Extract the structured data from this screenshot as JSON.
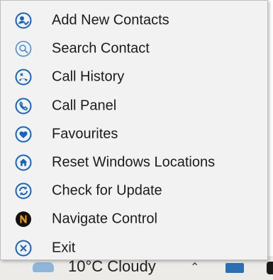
{
  "menu": {
    "items": [
      {
        "label": "Add New Contacts",
        "icon": "add-contact-icon"
      },
      {
        "label": "Search Contact",
        "icon": "search-icon"
      },
      {
        "label": "Call History",
        "icon": "call-history-icon"
      },
      {
        "label": "Call Panel",
        "icon": "phone-icon"
      },
      {
        "label": "Favourites",
        "icon": "heart-icon"
      },
      {
        "label": "Reset Windows Locations",
        "icon": "home-icon"
      },
      {
        "label": "Check for Update",
        "icon": "refresh-icon"
      },
      {
        "label": "Navigate Control",
        "icon": "navigate-n-icon"
      },
      {
        "label": "Exit",
        "icon": "close-icon"
      }
    ]
  },
  "taskbar": {
    "weather_text": "10°C  Cloudy"
  },
  "colors": {
    "icon_blue": "#1565c0",
    "menu_bg": "#f2f2f2",
    "navigate_orange": "#f39c12"
  }
}
